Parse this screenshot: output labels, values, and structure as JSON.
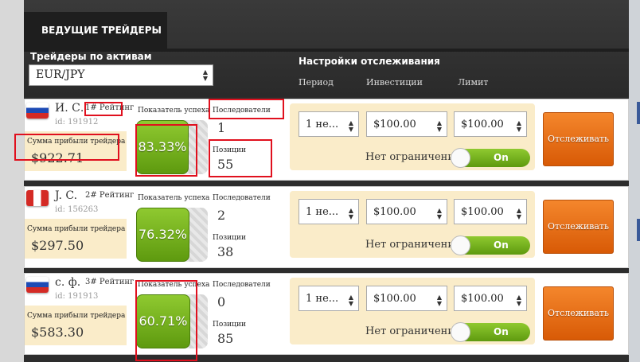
{
  "tab_title": "ВЕДУЩИЕ ТРЕЙДЕРЫ",
  "assets_label": "Трейдеры по активам",
  "asset_select": {
    "value": "EUR/JPY"
  },
  "tracking_label": "Настройки отслеживания",
  "columns": {
    "period": "Период",
    "investments": "Инвестиции",
    "limit": "Лимит"
  },
  "labels": {
    "success": "Показатель успеха",
    "followers": "Последователи",
    "positions": "Позиции",
    "profit": "Сумма прибыли трейдера",
    "no_limit": "Нет ограничения",
    "toggle_on": "On",
    "follow_button": "Отслеживать"
  },
  "traders": [
    {
      "name": "И. С.",
      "rank": "1# Рейтинг",
      "id": "id: 191912",
      "flag": "russia-flag-icon",
      "success": "83.33%",
      "success_fraction": 0.8333,
      "followers": "1",
      "positions": "55",
      "profit": "$922.71",
      "period": "1 не...",
      "investment": "$100.00",
      "limit": "$100.00"
    },
    {
      "name": "J. C.",
      "rank": "2# Рейтинг",
      "id": "id: 156263",
      "flag": "peru-flag-icon",
      "success": "76.32%",
      "success_fraction": 0.7632,
      "followers": "2",
      "positions": "38",
      "profit": "$297.50",
      "period": "1 не...",
      "investment": "$100.00",
      "limit": "$100.00"
    },
    {
      "name": "с. ф.",
      "rank": "3# Рейтинг",
      "id": "id: 191913",
      "flag": "russia-flag-icon",
      "success": "60.71%",
      "success_fraction": 0.6071,
      "followers": "0",
      "positions": "85",
      "profit": "$583.30",
      "period": "1 не...",
      "investment": "$100.00",
      "limit": "$100.00"
    }
  ],
  "colors": {
    "accent_green": "#7ab51d",
    "button_orange": "#e8700f",
    "highlight_red": "#e0101e"
  }
}
